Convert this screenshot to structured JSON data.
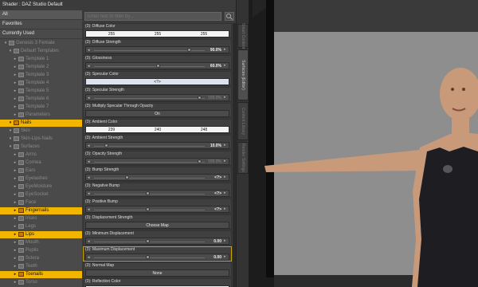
{
  "header": {
    "title": "Shader : DAZ Studio Default"
  },
  "categories": [
    {
      "label": "All",
      "selected": true
    },
    {
      "label": "Favorites",
      "selected": false
    },
    {
      "label": "Currently Used",
      "selected": false
    }
  ],
  "tree": [
    {
      "label": "Genesis 3 Female",
      "indent": 0,
      "highlight": false
    },
    {
      "label": "Default Templates",
      "indent": 1,
      "highlight": false
    },
    {
      "label": "Template 1",
      "indent": 2,
      "highlight": false
    },
    {
      "label": "Template 2",
      "indent": 2,
      "highlight": false
    },
    {
      "label": "Template 3",
      "indent": 2,
      "highlight": false
    },
    {
      "label": "Template 4",
      "indent": 2,
      "highlight": false
    },
    {
      "label": "Template 5",
      "indent": 2,
      "highlight": false
    },
    {
      "label": "Template 6",
      "indent": 2,
      "highlight": false
    },
    {
      "label": "Template 7",
      "indent": 2,
      "highlight": false
    },
    {
      "label": "Parameters",
      "indent": 2,
      "highlight": false
    },
    {
      "label": "Nails",
      "indent": 1,
      "highlight": true
    },
    {
      "label": "Skin",
      "indent": 1,
      "highlight": false
    },
    {
      "label": "Skin-Lips-Nails",
      "indent": 1,
      "highlight": false
    },
    {
      "label": "Surfaces",
      "indent": 1,
      "highlight": false
    },
    {
      "label": "Arms",
      "indent": 2,
      "highlight": false
    },
    {
      "label": "Cornea",
      "indent": 2,
      "highlight": false
    },
    {
      "label": "Ears",
      "indent": 2,
      "highlight": false
    },
    {
      "label": "Eyelashes",
      "indent": 2,
      "highlight": false
    },
    {
      "label": "EyeMoisture",
      "indent": 2,
      "highlight": false
    },
    {
      "label": "EyeSocket",
      "indent": 2,
      "highlight": false
    },
    {
      "label": "Face",
      "indent": 2,
      "highlight": false
    },
    {
      "label": "Fingernails",
      "indent": 2,
      "highlight": true
    },
    {
      "label": "Irises",
      "indent": 2,
      "highlight": false
    },
    {
      "label": "Legs",
      "indent": 2,
      "highlight": false
    },
    {
      "label": "Lips",
      "indent": 2,
      "highlight": true
    },
    {
      "label": "Mouth",
      "indent": 2,
      "highlight": false
    },
    {
      "label": "Pupils",
      "indent": 2,
      "highlight": false
    },
    {
      "label": "Sclera",
      "indent": 2,
      "highlight": false
    },
    {
      "label": "Teeth",
      "indent": 2,
      "highlight": false
    },
    {
      "label": "Toenails",
      "indent": 2,
      "highlight": true
    },
    {
      "label": "Torso",
      "indent": 2,
      "highlight": false
    }
  ],
  "filter": {
    "placeholder": "Enter text to filter by..."
  },
  "properties": [
    {
      "title": "(3): Diffuse Color",
      "kind": "color",
      "r": "255",
      "g": "255",
      "b": "255"
    },
    {
      "title": "(3): Diffuse Strength",
      "kind": "slider",
      "value": "90.0%",
      "level": 0.9,
      "dim": false
    },
    {
      "title": "(3): Glossiness",
      "kind": "slider",
      "value": "60.0%",
      "level": 0.6,
      "dim": false
    },
    {
      "title": "(3): Specular Color",
      "kind": "button-blue",
      "label": "<?>"
    },
    {
      "title": "(3): Specular Strength",
      "kind": "slider",
      "value": "100.0%",
      "level": 1.0,
      "dim": true
    },
    {
      "title": "(3): Multiply Specular Through Opacity",
      "kind": "button",
      "label": "On"
    },
    {
      "title": "(3): Ambient Color",
      "kind": "color",
      "r": "239",
      "g": "240",
      "b": "248"
    },
    {
      "title": "(3): Ambient Strength",
      "kind": "slider",
      "value": "10.0%",
      "level": 0.1,
      "dim": false
    },
    {
      "title": "(3): Opacity Strength",
      "kind": "slider",
      "value": "100.0%",
      "level": 1.0,
      "dim": true
    },
    {
      "title": "(3): Bump Strength",
      "kind": "slider",
      "value": "<?>",
      "level": 0.3,
      "dim": false
    },
    {
      "title": "(3): Negative Bump",
      "kind": "slider",
      "value": "<?>",
      "level": 0.5,
      "dim": false
    },
    {
      "title": "(3): Positive Bump",
      "kind": "slider",
      "value": "<?>",
      "level": 0.5,
      "dim": false
    },
    {
      "title": "(3): Displacement Strength",
      "kind": "button",
      "label": "Choose Map"
    },
    {
      "title": "(3): Minimum Displacement",
      "kind": "slider",
      "value": "0.00",
      "level": 0.5,
      "dim": false
    },
    {
      "title": "(3): Maximum Displacement",
      "kind": "slider",
      "value": "0.00",
      "level": 0.5,
      "dim": false,
      "active": true
    },
    {
      "title": "(3): Normal Map",
      "kind": "button",
      "label": "None"
    },
    {
      "title": "(3): Reflection Color",
      "kind": "color",
      "r": "",
      "g": "",
      "b": ""
    }
  ],
  "tabs": [
    {
      "label": "Smart Content",
      "active": false
    },
    {
      "label": "Surfaces (Editor)",
      "active": true
    },
    {
      "label": "Content Library",
      "active": false
    },
    {
      "label": "Render Settings",
      "active": false
    }
  ],
  "viewport": {
    "background": "#1c1c1c",
    "wall_color": "#8e8e8e",
    "skin_color": "#c99a79",
    "top_color": "#1e1e22"
  }
}
